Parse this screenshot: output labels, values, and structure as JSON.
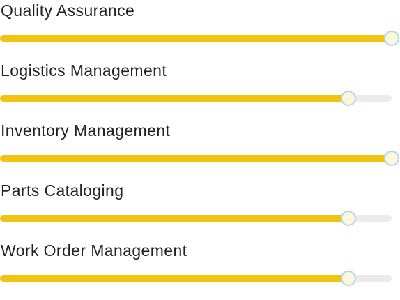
{
  "colors": {
    "fill": "#f1c40f",
    "track": "#ebebeb",
    "thumb_border": "#a9d8f5",
    "thumb_fill": "#fdf6d8",
    "label": "#222222"
  },
  "skills": [
    {
      "label": "Quality Assurance",
      "value": 100
    },
    {
      "label": "Logistics Management",
      "value": 89
    },
    {
      "label": "Inventory Management",
      "value": 100
    },
    {
      "label": "Parts Cataloging",
      "value": 89
    },
    {
      "label": "Work Order Management",
      "value": 89
    }
  ]
}
